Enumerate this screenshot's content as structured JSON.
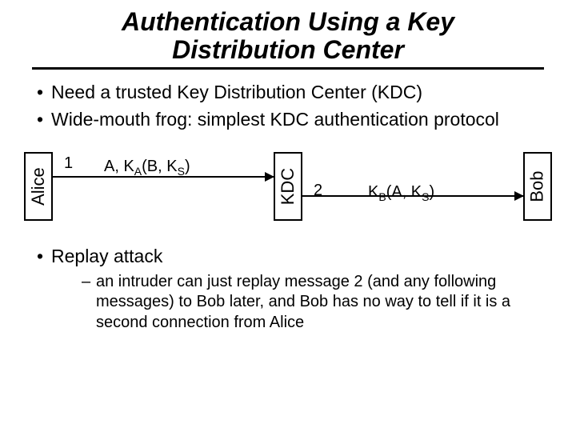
{
  "title_line1": "Authentication Using a Key",
  "title_line2": "Distribution Center",
  "bullets": {
    "b1": "Need a trusted Key Distribution Center (KDC)",
    "b2": "Wide-mouth frog: simplest KDC authentication protocol",
    "b3": "Replay attack",
    "b3_sub": "an intruder can just replay message 2 (and any following messages)  to Bob later, and Bob has no way to tell if it is a second connection from Alice"
  },
  "diagram": {
    "alice": "Alice",
    "kdc": "KDC",
    "bob": "Bob",
    "num1": "1",
    "num2": "2",
    "msg1_a": "A, K",
    "msg1_suba": "A",
    "msg1_b": "(B, K",
    "msg1_subs": "S",
    "msg1_c": ")",
    "msg2_a": "K",
    "msg2_subb": "B",
    "msg2_b": "(A, K",
    "msg2_subs": "S",
    "msg2_c": ")"
  }
}
